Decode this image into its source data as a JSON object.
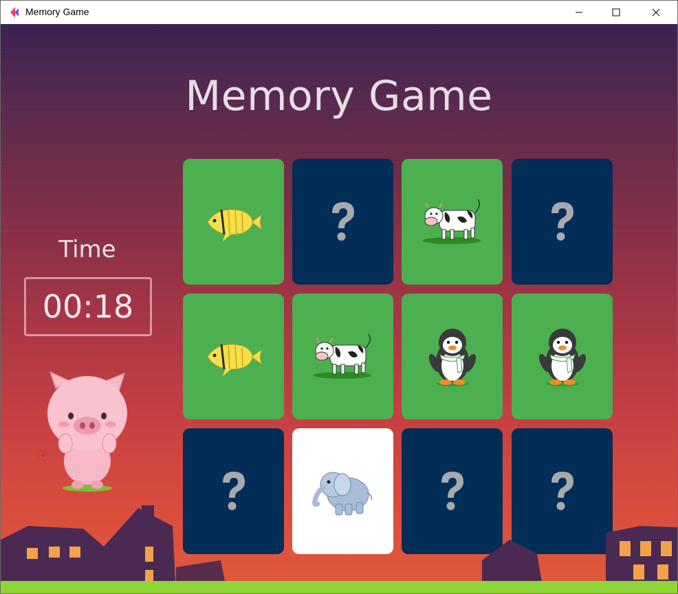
{
  "window": {
    "title": "Memory Game",
    "controls": [
      "minimize",
      "maximize",
      "close"
    ]
  },
  "game": {
    "title": "Memory Game",
    "time_label": "Time",
    "timer": "00:18"
  },
  "board": {
    "rows": 3,
    "columns": 4,
    "cards": [
      {
        "state": "matched",
        "animal": "fish"
      },
      {
        "state": "hidden",
        "animal": "question-mark"
      },
      {
        "state": "matched",
        "animal": "cow"
      },
      {
        "state": "hidden",
        "animal": "question-mark"
      },
      {
        "state": "matched",
        "animal": "fish"
      },
      {
        "state": "matched",
        "animal": "cow"
      },
      {
        "state": "matched",
        "animal": "penguin"
      },
      {
        "state": "matched",
        "animal": "penguin"
      },
      {
        "state": "hidden",
        "animal": "question-mark"
      },
      {
        "state": "revealed",
        "animal": "elephant"
      },
      {
        "state": "hidden",
        "animal": "question-mark"
      },
      {
        "state": "hidden",
        "animal": "question-mark"
      }
    ]
  },
  "colors": {
    "hidden_card": "#012d57",
    "matched_card": "#4caf50",
    "revealed_card": "#ffffff",
    "question_mark": "#a9a9ad",
    "title_text": "#e7dde6",
    "grass": "#8fd638",
    "house": "#4a2a52",
    "window_light": "#f4a24a"
  }
}
